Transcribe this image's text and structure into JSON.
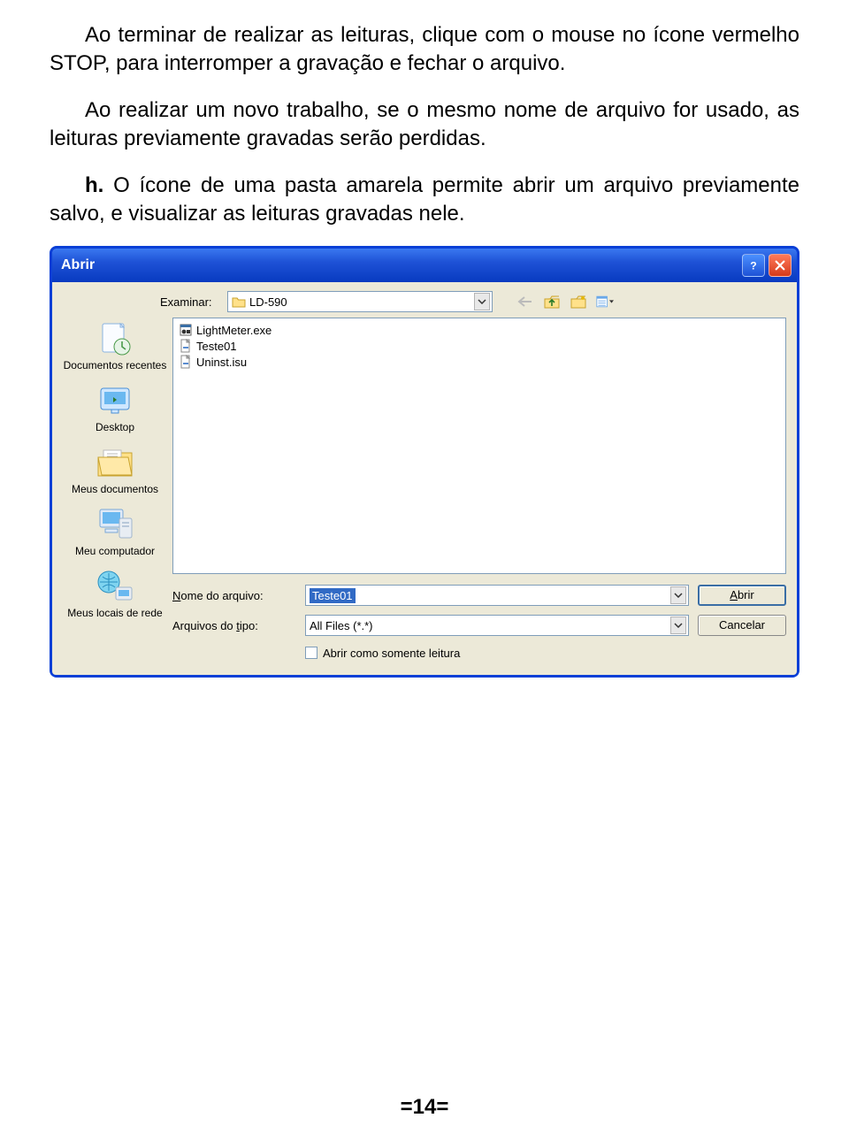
{
  "doc": {
    "p1": "Ao terminar de realizar as leituras, clique com o mouse no ícone vermelho STOP, para interromper a gravação e fechar o arquivo.",
    "p2": "Ao realizar um novo trabalho, se o mesmo nome de arquivo for usado, as leituras previamente gravadas serão perdidas.",
    "p3_prefix": "h.",
    "p3": " O ícone de uma pasta amarela permite abrir um arquivo previamente salvo, e visualizar as leituras gravadas nele."
  },
  "dialog": {
    "title": "Abrir",
    "examine_label": "Examinar:",
    "examine_value": "LD-590",
    "files": [
      {
        "name": "LightMeter.exe",
        "icon": "exe"
      },
      {
        "name": "Teste01",
        "icon": "generic"
      },
      {
        "name": "Uninst.isu",
        "icon": "generic"
      }
    ],
    "places": [
      {
        "label": "Documentos recentes",
        "icon": "recent"
      },
      {
        "label": "Desktop",
        "icon": "desktop"
      },
      {
        "label": "Meus documentos",
        "icon": "mydocs"
      },
      {
        "label": "Meu computador",
        "icon": "mycomp"
      },
      {
        "label": "Meus locais de rede",
        "icon": "network"
      }
    ],
    "filename_label": "Nome do arquivo:",
    "filename_value": "Teste01",
    "filetype_label": "Arquivos do tipo:",
    "filetype_value": "All Files (*.*)",
    "readonly_label": "Abrir como somente leitura",
    "open_btn": "Abrir",
    "cancel_btn": "Cancelar"
  },
  "footer": "=14="
}
